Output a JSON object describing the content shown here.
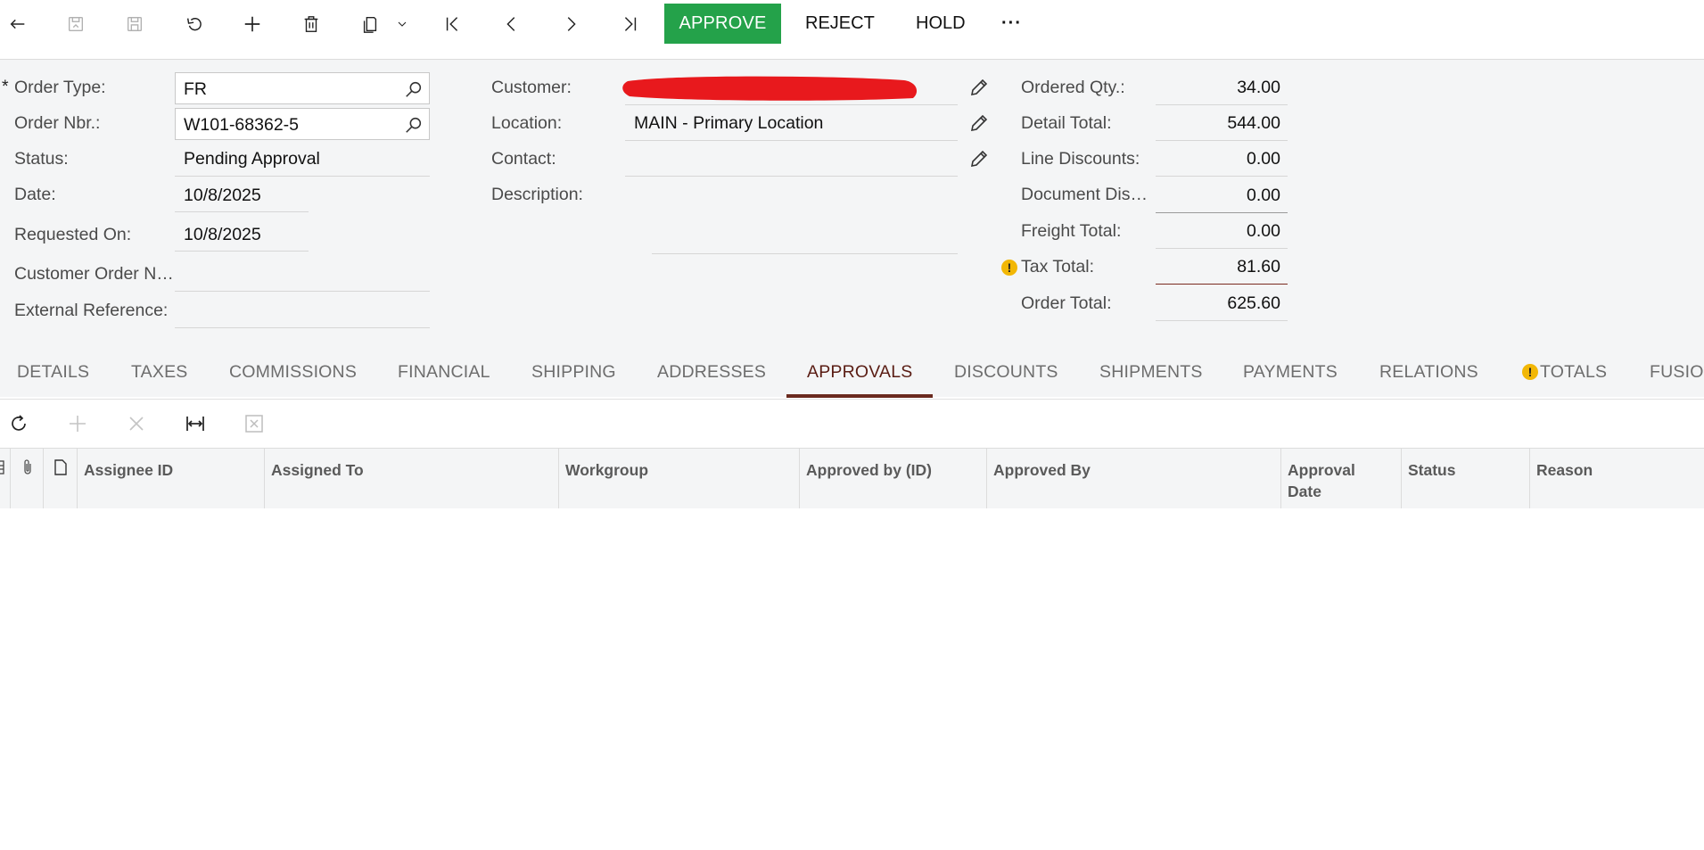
{
  "toolbar": {
    "approve_label": "APPROVE",
    "reject_label": "REJECT",
    "hold_label": "HOLD",
    "more_label": "···"
  },
  "form": {
    "order_type": {
      "label": "Order Type:",
      "value": "FR",
      "required_mark": "*"
    },
    "order_nbr": {
      "label": "Order Nbr.:",
      "value": "W101-68362-5"
    },
    "status": {
      "label": "Status:",
      "value": "Pending Approval"
    },
    "date": {
      "label": "Date:",
      "value": "10/8/2025"
    },
    "requested_on": {
      "label": "Requested On:",
      "value": "10/8/2025"
    },
    "customer_order_nbr": {
      "label": "Customer Order N…",
      "value": ""
    },
    "external_reference": {
      "label": "External Reference:",
      "value": ""
    },
    "customer": {
      "label": "Customer:",
      "value": "",
      "redaction_color": "#e8191d"
    },
    "location": {
      "label": "Location:",
      "value": "MAIN - Primary Location"
    },
    "contact": {
      "label": "Contact:",
      "value": ""
    },
    "description": {
      "label": "Description:",
      "value": ""
    }
  },
  "totals": {
    "ordered_qty": {
      "label": "Ordered Qty.:",
      "value": "34.00"
    },
    "detail_total": {
      "label": "Detail Total:",
      "value": "544.00"
    },
    "line_discounts": {
      "label": "Line Discounts:",
      "value": "0.00"
    },
    "document_discounts": {
      "label": "Document Dis…",
      "value": "0.00"
    },
    "freight_total": {
      "label": "Freight Total:",
      "value": "0.00"
    },
    "tax_total": {
      "label": "Tax Total:",
      "value": "81.60",
      "warning": "!"
    },
    "order_total": {
      "label": "Order Total:",
      "value": "625.60"
    }
  },
  "tabs": [
    {
      "label": "DETAILS"
    },
    {
      "label": "TAXES"
    },
    {
      "label": "COMMISSIONS"
    },
    {
      "label": "FINANCIAL"
    },
    {
      "label": "SHIPPING"
    },
    {
      "label": "ADDRESSES"
    },
    {
      "label": "APPROVALS",
      "active": true
    },
    {
      "label": "DISCOUNTS"
    },
    {
      "label": "SHIPMENTS"
    },
    {
      "label": "PAYMENTS"
    },
    {
      "label": "RELATIONS"
    },
    {
      "label": "TOTALS",
      "warning": "!"
    },
    {
      "label": "FUSIO"
    }
  ],
  "grid": {
    "columns": [
      {
        "label": "Assignee ID"
      },
      {
        "label": "Assigned To"
      },
      {
        "label": "Workgroup"
      },
      {
        "label": "Approved by (ID)"
      },
      {
        "label": "Approved By"
      },
      {
        "label": "Approval Date"
      },
      {
        "label": "Status"
      },
      {
        "label": "Reason"
      }
    ],
    "rows": []
  },
  "colors": {
    "approve_green": "#24a24a",
    "active_tab": "#5a1d14",
    "warning_yellow": "#f2b705",
    "form_bg": "#f4f5f6"
  }
}
